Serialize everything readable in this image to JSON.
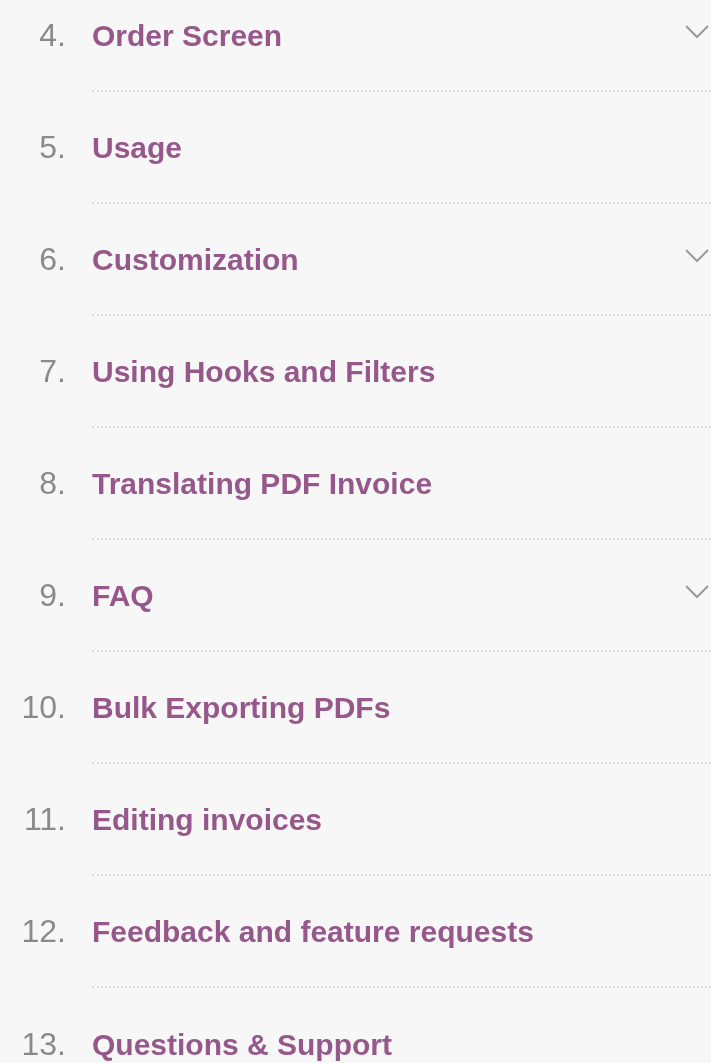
{
  "toc_items": [
    {
      "number": "4.",
      "title": "Order Screen",
      "expandable": true
    },
    {
      "number": "5.",
      "title": "Usage",
      "expandable": false
    },
    {
      "number": "6.",
      "title": "Customization",
      "expandable": true
    },
    {
      "number": "7.",
      "title": "Using Hooks and Filters",
      "expandable": false
    },
    {
      "number": "8.",
      "title": "Translating PDF Invoice",
      "expandable": false
    },
    {
      "number": "9.",
      "title": "FAQ",
      "expandable": true
    },
    {
      "number": "10.",
      "title": "Bulk Exporting PDFs",
      "expandable": false
    },
    {
      "number": "11.",
      "title": "Editing invoices",
      "expandable": false
    },
    {
      "number": "12.",
      "title": "Feedback and feature requests",
      "expandable": false
    },
    {
      "number": "13.",
      "title": "Questions & Support",
      "expandable": false
    }
  ]
}
